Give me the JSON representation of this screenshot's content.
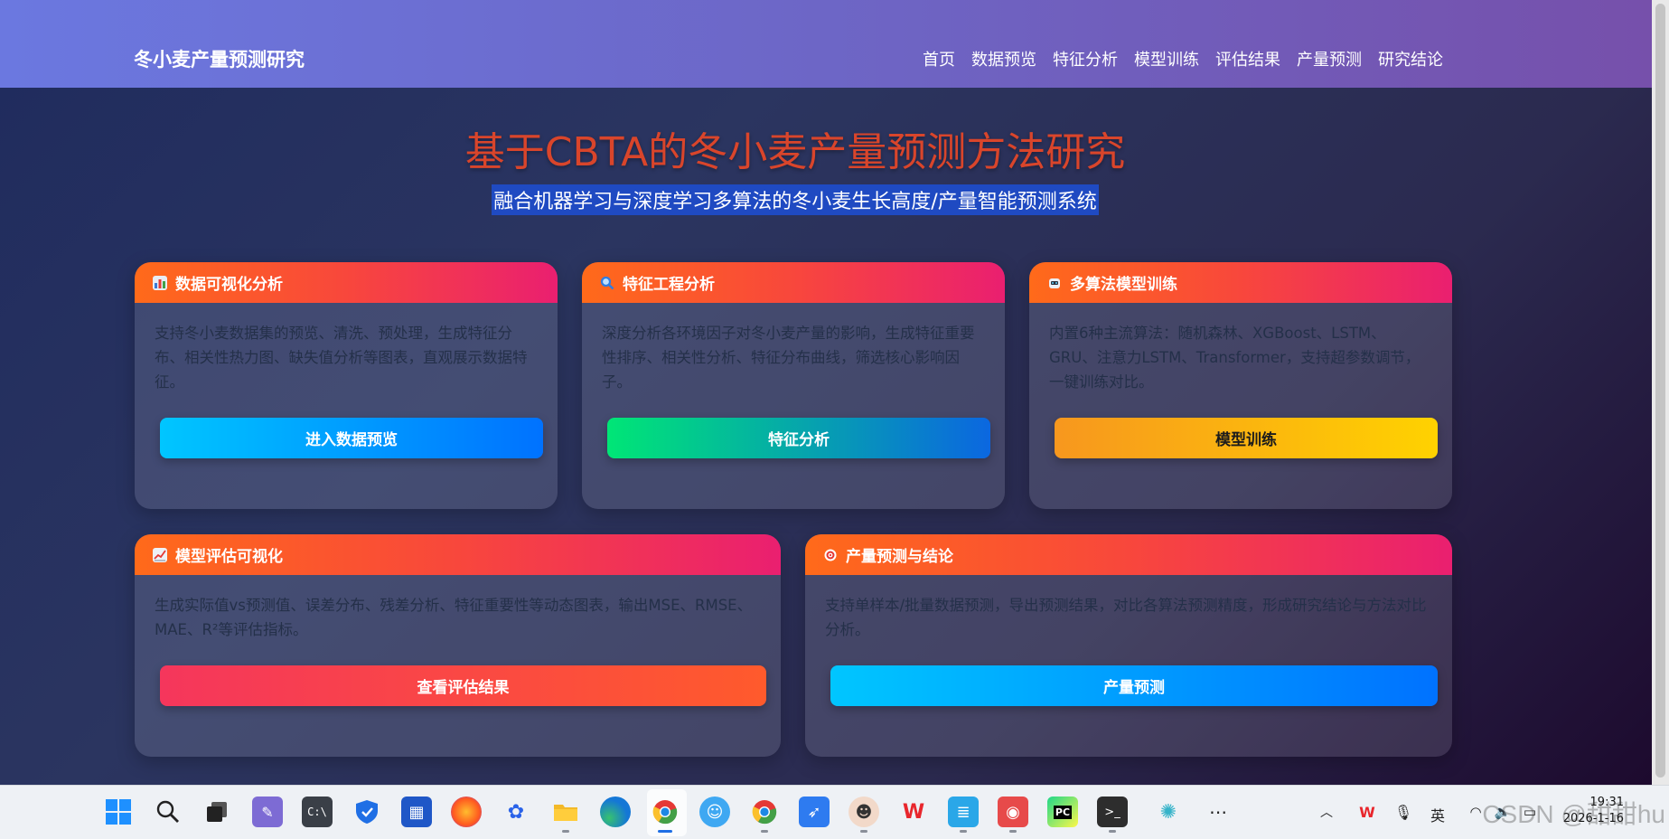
{
  "brand": "冬小麦产量预测研究",
  "nav": [
    "首页",
    "数据预览",
    "特征分析",
    "模型训练",
    "评估结果",
    "产量预测",
    "研究结论"
  ],
  "hero": {
    "title": "基于CBTA的冬小麦产量预测方法研究",
    "subtitle": "融合机器学习与深度学习多算法的冬小麦生长高度/产量智能预测系统"
  },
  "cards": [
    {
      "title": "数据可视化分析",
      "icon": "bar-chart-icon",
      "desc": "支持冬小麦数据集的预览、清洗、预处理，生成特征分布、相关性热力图、缺失值分析等图表，直观展示数据特征。",
      "button": "进入数据预览",
      "button_colors": [
        "#00c6ff",
        "#0072ff"
      ]
    },
    {
      "title": "特征工程分析",
      "icon": "magnifier-icon",
      "desc": "深度分析各环境因子对冬小麦产量的影响，生成特征重要性排序、相关性分析、特征分布曲线，筛选核心影响因子。",
      "button": "特征分析",
      "button_colors": [
        "#00e676",
        "#0b67e0"
      ]
    },
    {
      "title": "多算法模型训练",
      "icon": "robot-icon",
      "desc": "内置6种主流算法：随机森林、XGBoost、LSTM、GRU、注意力LSTM、Transformer，支持超参数调节，一键训练对比。",
      "button": "模型训练",
      "button_colors": [
        "#f7971e",
        "#ffd200"
      ]
    },
    {
      "title": "模型评估可视化",
      "icon": "line-chart-icon",
      "desc": "生成实际值vs预测值、误差分布、残差分析、特征重要性等动态图表，输出MSE、RMSE、MAE、R²等评估指标。",
      "button": "查看评估结果",
      "button_colors": [
        "#f5365c",
        "#ff5a2c"
      ]
    },
    {
      "title": "产量预测与结论",
      "icon": "target-icon",
      "desc": "支持单样本/批量数据预测，导出预测结果，对比各算法预测精度，形成研究结论与方法对比分析。",
      "button": "产量预测",
      "button_colors": [
        "#00c6ff",
        "#0072ff"
      ]
    }
  ],
  "taskbar": {
    "apps": [
      "windows-start-icon",
      "search-icon",
      "task-view-icon",
      "paint-icon",
      "terminal-app-icon",
      "defender-icon",
      "store-icon",
      "firefox-icon",
      "baidu-icon",
      "file-explorer-icon",
      "edge-icon",
      "chrome-icon",
      "qq-icon",
      "chrome-alt-icon",
      "feishu-icon",
      "avatar-app-icon",
      "wps-icon",
      "notepad-icon",
      "app-red-icon",
      "pycharm-icon",
      "cmd-icon",
      "copilot-icon",
      "more-icon"
    ],
    "ime": "英",
    "time": "19:31",
    "date": "2026-1-16",
    "watermark": "CSDN @甜甜hu"
  }
}
